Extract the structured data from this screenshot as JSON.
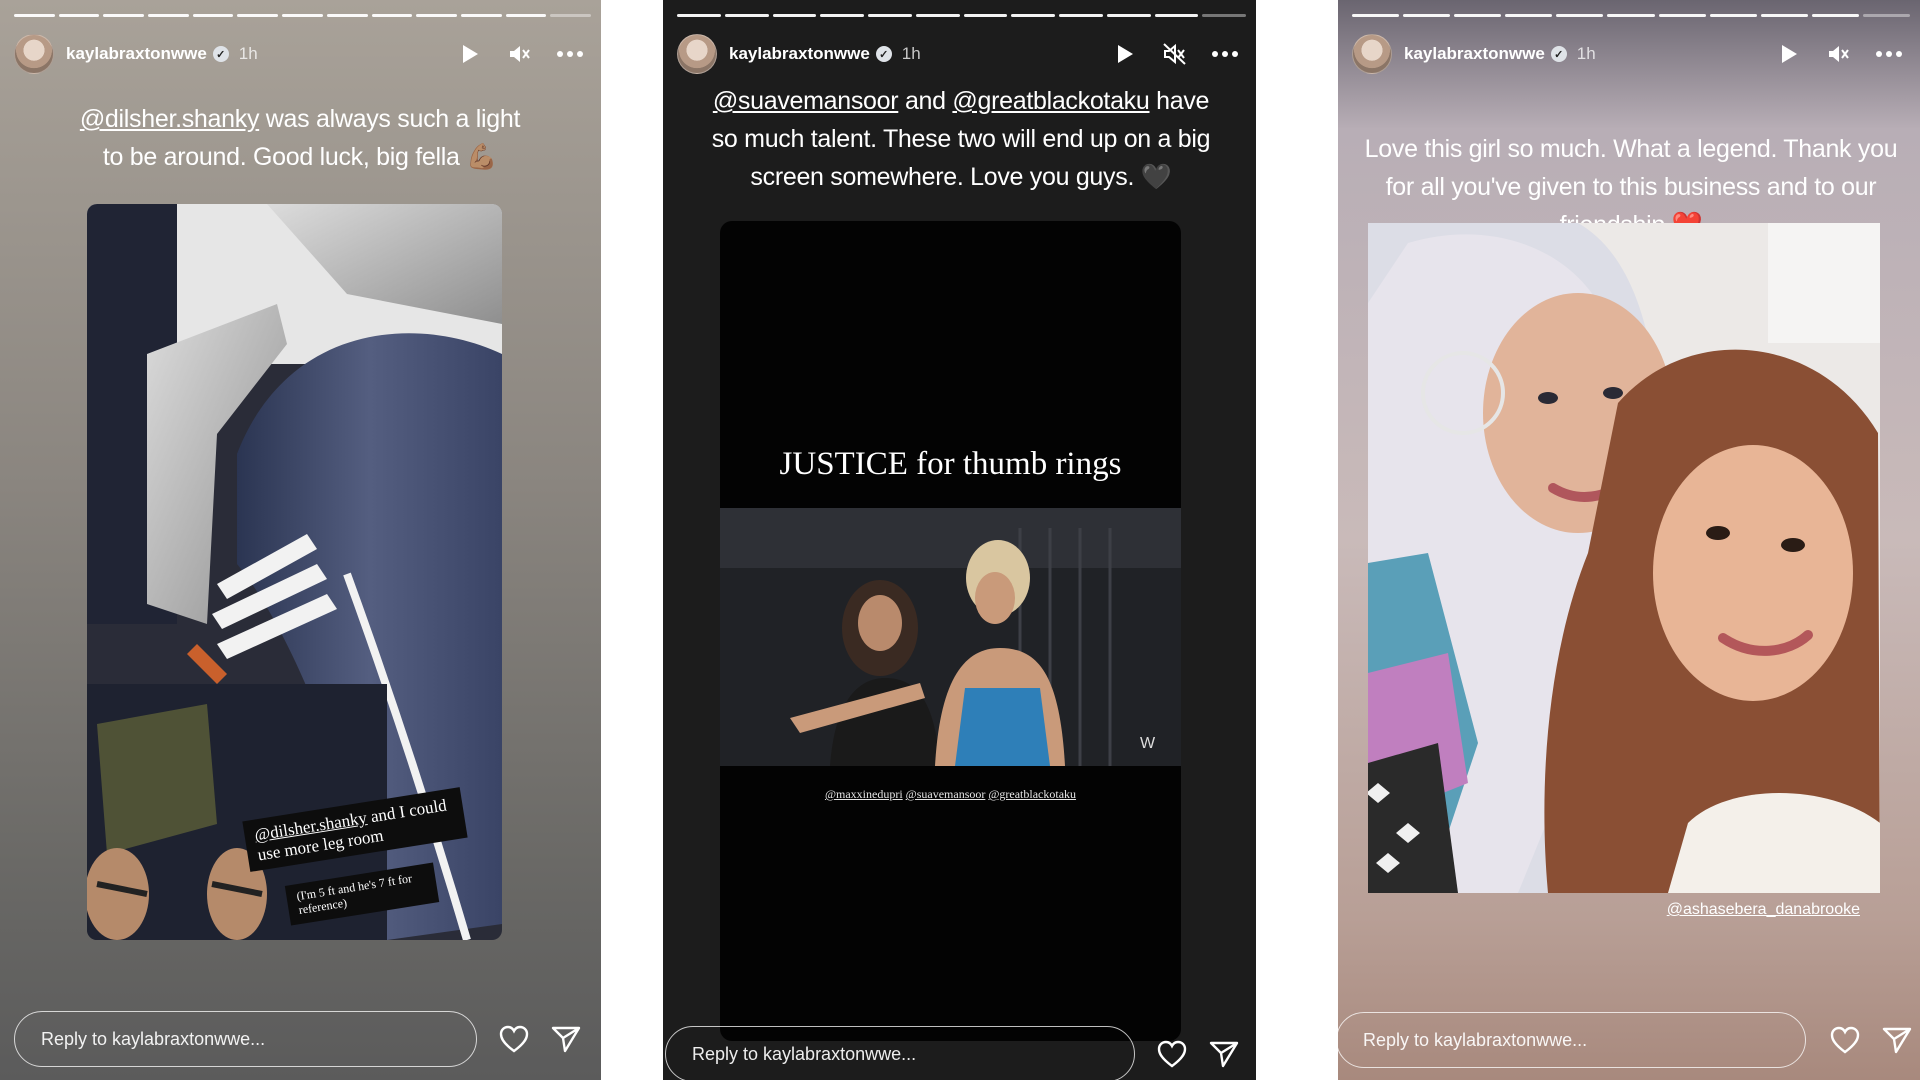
{
  "colors": {
    "story_progress": "#ffffff",
    "text": "#ffffff",
    "heart_red": "#e0242b"
  },
  "stories": [
    {
      "username": "kaylabraxtonwwe",
      "time": "1h",
      "caption_mention": "@dilsher.shanky",
      "caption_text": " was always such a light to be around. Good luck, big fella 💪🏽",
      "sticker_mention": "@dilsher.shanky",
      "sticker_text": " and I could use more leg room",
      "sticker_subtext": "(I'm 5 ft and he's 7 ft for reference)",
      "reply_placeholder": "Reply to kaylabraxtonwwe...",
      "icons": {
        "play": "play-icon",
        "mute": "speaker-muted-icon",
        "more": "more-horizontal-icon",
        "like": "heart-icon",
        "share": "send-icon"
      }
    },
    {
      "username": "kaylabraxtonwwe",
      "time": "1h",
      "caption_mention1": "@suavemansoor",
      "caption_and": " and ",
      "caption_mention2": "@greatblackotaku",
      "caption_text": " have so much talent. These two will end up on a big screen somewhere. Love you guys. 🖤",
      "video_title": "JUSTICE for thumb rings",
      "video_credits": [
        "@maxxinedupri",
        "@suavemansoor",
        "@greatblackotaku"
      ],
      "reply_placeholder": "Reply to kaylabraxtonwwe...",
      "icons": {
        "play": "play-icon",
        "mute": "speaker-muted-icon",
        "more": "more-horizontal-icon",
        "like": "heart-icon",
        "share": "send-icon"
      }
    },
    {
      "username": "kaylabraxtonwwe",
      "time": "1h",
      "caption_text": "Love this girl so much. What a legend. Thank you for all you've given to this business and to our friendship ❤️",
      "photo_tag": "@ashasebera_danabrooke",
      "reply_placeholder": "Reply to kaylabraxtonwwe...",
      "icons": {
        "play": "play-icon",
        "mute": "speaker-muted-icon",
        "more": "more-horizontal-icon",
        "like": "heart-icon",
        "share": "send-icon"
      }
    }
  ]
}
